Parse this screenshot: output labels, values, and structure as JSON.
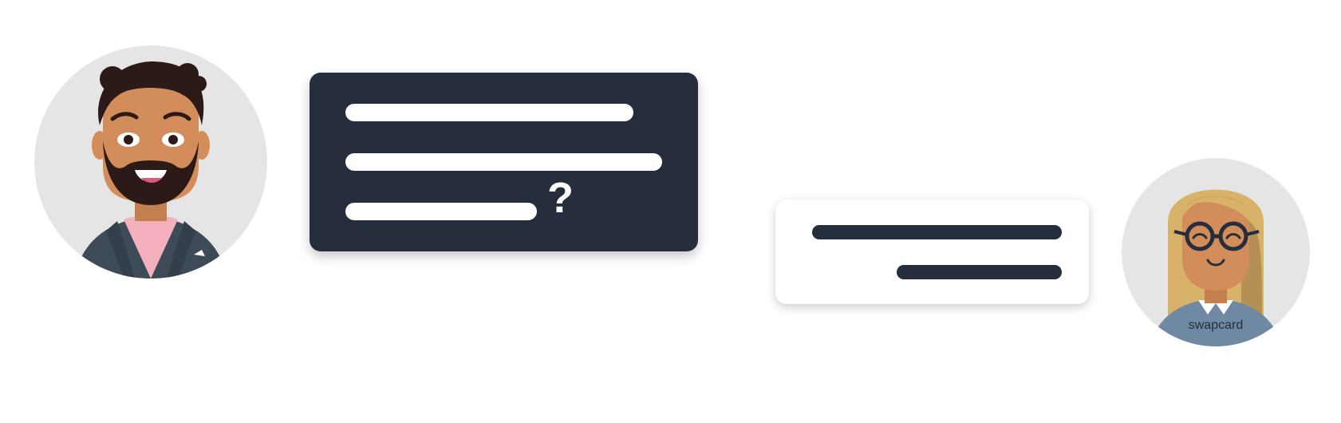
{
  "question_bubble": {
    "symbol": "?",
    "color": "#262e3d"
  },
  "answer_bubble": {
    "color": "#ffffff"
  },
  "right_avatar": {
    "shirt_logo": "swapcard"
  },
  "colors": {
    "avatar_bg": "#e5e5e5",
    "dark": "#262e3d",
    "skin": "#d38d5a",
    "hair_dark": "#2b1a17",
    "hair_blonde": "#d9b26a",
    "jacket": "#3d4a57",
    "shirt_pink": "#f4b0bd",
    "sweater_blue": "#6f89a3",
    "logo_green": "#1ec3a0"
  }
}
